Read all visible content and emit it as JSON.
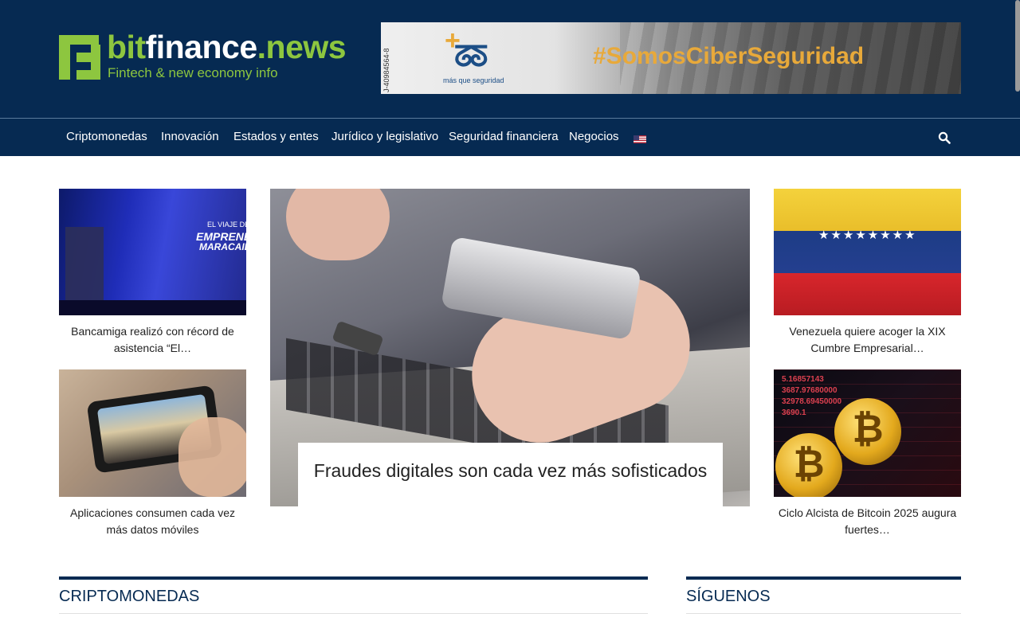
{
  "header": {
    "logo": {
      "name_part1": "bit",
      "name_part2": "finance",
      "name_part3": ".news",
      "tagline": "Fintech & new economy info"
    },
    "banner": {
      "vertical_text": "J-40984564-8",
      "brand_small": "más que seguridad",
      "hashtag": "#SomosCiberSeguridad"
    }
  },
  "nav": {
    "items": [
      {
        "label": "Criptomonedas"
      },
      {
        "label": "Innovación"
      },
      {
        "label": "Estados y entes"
      },
      {
        "label": "Jurídico y legislativo"
      },
      {
        "label": "Seguridad financiera"
      },
      {
        "label": "Negocios"
      }
    ],
    "flag_icon": "us-flag-icon",
    "search_icon": "search-icon"
  },
  "featured": {
    "hero": {
      "title": "Fraudes digitales son cada vez más sofisticados"
    },
    "left": [
      {
        "title": "Bancamiga realizó con récord de asistencia “El…",
        "image_text": [
          "EL VIAJE DEL",
          "EMPRENDEDOR",
          "MARACAIBO"
        ]
      },
      {
        "title": "Aplicaciones consumen cada vez más datos móviles"
      }
    ],
    "right": [
      {
        "title": "Venezuela quiere acoger la XIX Cumbre Empresarial…"
      },
      {
        "title": "Ciclo Alcista de Bitcoin 2025 augura fuertes…",
        "image_text": [
          "5.16857143",
          "3687.97680000",
          "32978.69450000",
          "3690.1"
        ]
      }
    ]
  },
  "sections": {
    "left_title": "CRIPTOMONEDAS",
    "right_title": "SÍGUENOS"
  },
  "colors": {
    "brand_navy": "#062a52",
    "brand_green": "#8dc63f",
    "banner_orange": "#e8a93a"
  }
}
